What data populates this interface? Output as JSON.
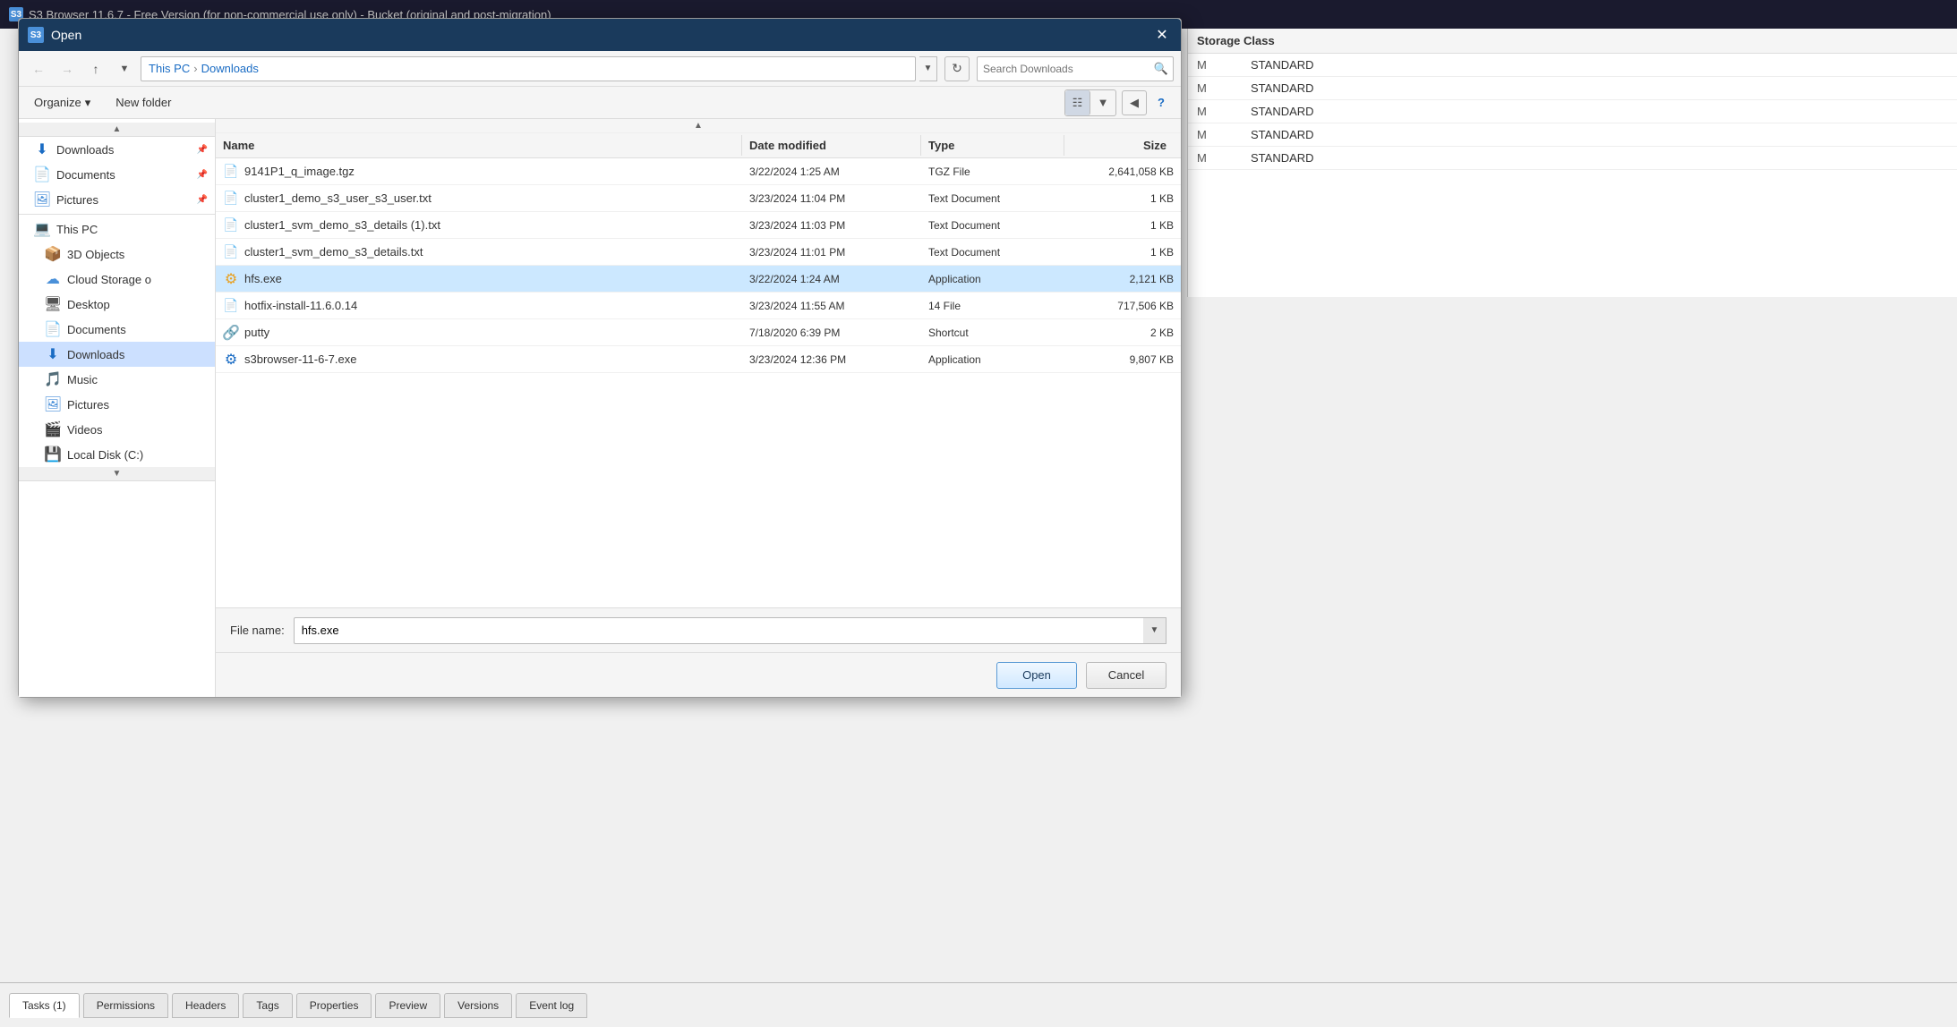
{
  "window": {
    "title": "S3 Browser 11.6.7 - Free Version (for non-commercial use only) - Bucket (original and post-migration)",
    "title_icon": "S3"
  },
  "dialog": {
    "title": "Open",
    "title_icon": "S3",
    "close_btn": "✕"
  },
  "navigation": {
    "back_tooltip": "Back",
    "forward_tooltip": "Forward",
    "up_tooltip": "Up",
    "down_tooltip": "Down",
    "breadcrumb": {
      "this_pc": "This PC",
      "separator1": "›",
      "downloads": "Downloads",
      "separator2": "›"
    },
    "search_placeholder": "Search Downloads",
    "refresh_tooltip": "Refresh"
  },
  "toolbar": {
    "organize_label": "Organize",
    "organize_arrow": "▾",
    "new_folder_label": "New folder",
    "view_icon": "⊞",
    "help_icon": "?"
  },
  "sidebar": {
    "scroll_up": "▲",
    "items": [
      {
        "id": "downloads-pinned",
        "icon": "⬇",
        "label": "Downloads",
        "pinned": true,
        "icon_color": "#1a6cc4"
      },
      {
        "id": "documents-pinned",
        "icon": "📄",
        "label": "Documents",
        "pinned": true,
        "icon_color": "#4a90d9"
      },
      {
        "id": "pictures-pinned",
        "icon": "🖼",
        "label": "Pictures",
        "pinned": true,
        "icon_color": "#4a90d9"
      },
      {
        "id": "this-pc",
        "icon": "💻",
        "label": "This PC",
        "pinned": false,
        "icon_color": "#555"
      },
      {
        "id": "3d-objects",
        "icon": "📦",
        "label": "3D Objects",
        "pinned": false,
        "icon_color": "#888"
      },
      {
        "id": "cloud-storage",
        "icon": "☁",
        "label": "Cloud Storage o",
        "pinned": false,
        "icon_color": "#4a90d9"
      },
      {
        "id": "desktop",
        "icon": "🖥",
        "label": "Desktop",
        "pinned": false,
        "icon_color": "#555"
      },
      {
        "id": "documents2",
        "icon": "📄",
        "label": "Documents",
        "pinned": false,
        "icon_color": "#4a90d9"
      },
      {
        "id": "downloads-active",
        "icon": "⬇",
        "label": "Downloads",
        "pinned": false,
        "icon_color": "#1a6cc4",
        "active": true
      },
      {
        "id": "music",
        "icon": "🎵",
        "label": "Music",
        "pinned": false,
        "icon_color": "#888"
      },
      {
        "id": "pictures2",
        "icon": "🖼",
        "label": "Pictures",
        "pinned": false,
        "icon_color": "#4a90d9"
      },
      {
        "id": "videos",
        "icon": "🎬",
        "label": "Videos",
        "pinned": false,
        "icon_color": "#888"
      },
      {
        "id": "local-disk",
        "icon": "💾",
        "label": "Local Disk (C:)",
        "pinned": false,
        "icon_color": "#888"
      }
    ],
    "scroll_down": "▾"
  },
  "file_list": {
    "columns": {
      "name": "Name",
      "date_modified": "Date modified",
      "type": "Type",
      "size": "Size"
    },
    "sort_indicator": "▲",
    "files": [
      {
        "id": "file-tgz",
        "icon": "📄",
        "icon_color": "#888",
        "name": "9141P1_q_image.tgz",
        "date_modified": "3/22/2024 1:25 AM",
        "type": "TGZ File",
        "size": "2,641,058 KB",
        "selected": false
      },
      {
        "id": "file-s3user",
        "icon": "📄",
        "icon_color": "#4a90d9",
        "name": "cluster1_demo_s3_user_s3_user.txt",
        "date_modified": "3/23/2024 11:04 PM",
        "type": "Text Document",
        "size": "1 KB",
        "selected": false
      },
      {
        "id": "file-s3details1",
        "icon": "📄",
        "icon_color": "#4a90d9",
        "name": "cluster1_svm_demo_s3_details (1).txt",
        "date_modified": "3/23/2024 11:03 PM",
        "type": "Text Document",
        "size": "1 KB",
        "selected": false
      },
      {
        "id": "file-s3details",
        "icon": "📄",
        "icon_color": "#4a90d9",
        "name": "cluster1_svm_demo_s3_details.txt",
        "date_modified": "3/23/2024 11:01 PM",
        "type": "Text Document",
        "size": "1 KB",
        "selected": false
      },
      {
        "id": "file-hfs",
        "icon": "⚙",
        "icon_color": "#e8a020",
        "name": "hfs.exe",
        "date_modified": "3/22/2024 1:24 AM",
        "type": "Application",
        "size": "2,121 KB",
        "selected": true
      },
      {
        "id": "file-hotfix",
        "icon": "📄",
        "icon_color": "#888",
        "name": "hotfix-install-11.6.0.14",
        "date_modified": "3/23/2024 11:55 AM",
        "type": "14 File",
        "size": "717,506 KB",
        "selected": false
      },
      {
        "id": "file-putty",
        "icon": "🔗",
        "icon_color": "#888",
        "name": "putty",
        "date_modified": "7/18/2020 6:39 PM",
        "type": "Shortcut",
        "size": "2 KB",
        "selected": false
      },
      {
        "id": "file-s3browser",
        "icon": "⚙",
        "icon_color": "#1a6cc4",
        "name": "s3browser-11-6-7.exe",
        "date_modified": "3/23/2024 12:36 PM",
        "type": "Application",
        "size": "9,807 KB",
        "selected": false
      }
    ]
  },
  "filename_field": {
    "label": "File name:",
    "value": "hfs.exe",
    "placeholder": ""
  },
  "buttons": {
    "open": "Open",
    "cancel": "Cancel"
  },
  "storage_class_panel": {
    "header": "Storage Class",
    "rows": [
      {
        "prefix": "M",
        "value": "STANDARD"
      },
      {
        "prefix": "M",
        "value": "STANDARD"
      },
      {
        "prefix": "M",
        "value": "STANDARD"
      },
      {
        "prefix": "M",
        "value": "STANDARD"
      },
      {
        "prefix": "M",
        "value": "STANDARD"
      }
    ]
  },
  "bottom_tabs": {
    "items": [
      {
        "id": "tasks",
        "label": "Tasks (1)",
        "active": true
      },
      {
        "id": "permissions",
        "label": "Permissions",
        "active": false
      },
      {
        "id": "headers",
        "label": "Headers",
        "active": false
      },
      {
        "id": "tags",
        "label": "Tags",
        "active": false
      },
      {
        "id": "properties",
        "label": "Properties",
        "active": false
      },
      {
        "id": "preview",
        "label": "Preview",
        "active": false
      },
      {
        "id": "versions",
        "label": "Versions",
        "active": false
      },
      {
        "id": "event-log",
        "label": "Event log",
        "active": false
      }
    ]
  }
}
